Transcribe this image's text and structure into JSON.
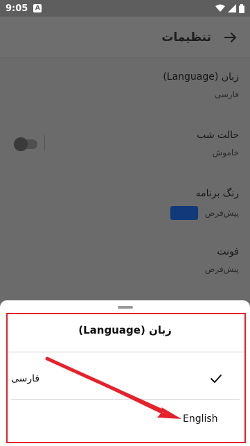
{
  "status_bar": {
    "time": "9:05",
    "notif_letter": "A"
  },
  "app_bar": {
    "title": "تنظیمات",
    "back_icon": "arrow-right-icon"
  },
  "settings": [
    {
      "title": "زبان (Language)",
      "value": "فارسی"
    },
    {
      "title": "حالت شب",
      "value": "خاموش",
      "switch_on": false
    },
    {
      "title": "رنگ برنامه",
      "value": "پیش‌فرض",
      "swatch_color": "#123a7a"
    },
    {
      "title": "فونت",
      "value": "پیش‌فرض"
    }
  ],
  "sheet": {
    "title": "زبان (Language)",
    "options": [
      {
        "label": "فارسی",
        "selected": true
      },
      {
        "label": "English",
        "selected": false
      }
    ]
  },
  "annotation": {
    "box_color": "#e5222b",
    "arrow_color": "#e5222b"
  }
}
